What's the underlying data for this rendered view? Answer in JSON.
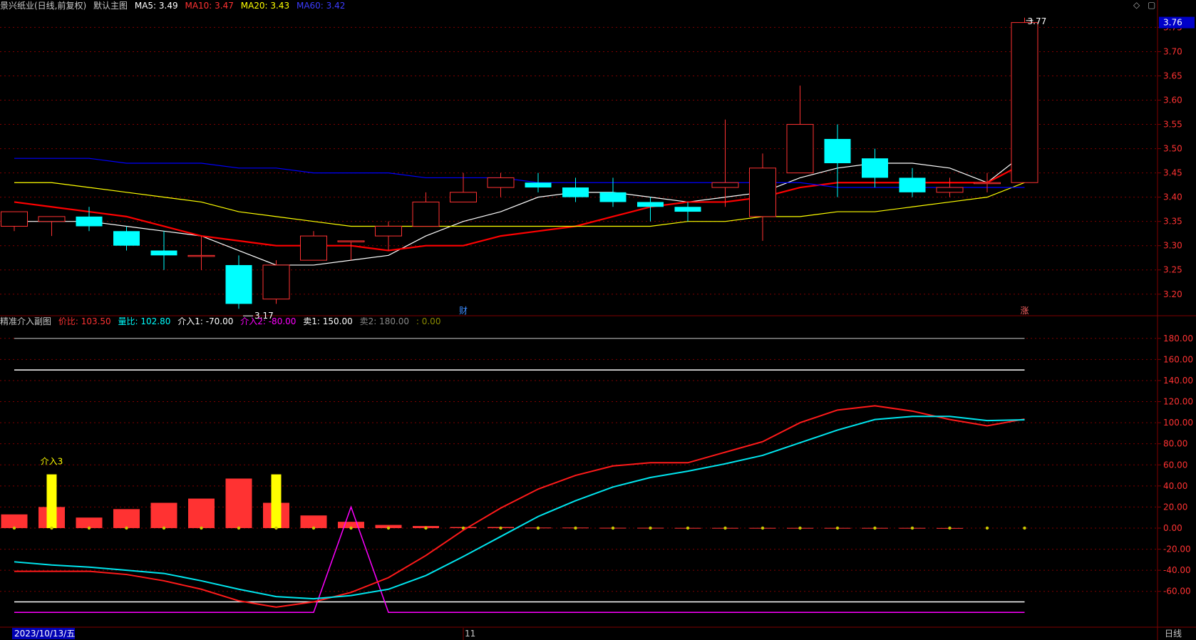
{
  "main_header": {
    "stock_title": "景兴纸业(日线,前复权)",
    "indicator_name": "默认主图",
    "ma5": "MA5: 3.49",
    "ma10": "MA10: 3.47",
    "ma20": "MA20: 3.43",
    "ma60": "MA60: 3.42"
  },
  "sub_header": {
    "indicator_name": "精准介入副图",
    "jiabi": "价比: 103.50",
    "liangbi": "量比: 102.80",
    "jieru1": "介入1: -70.00",
    "jieru2": "介入2: -80.00",
    "mai1": "卖1: 150.00",
    "mai2": "卖2: 180.00",
    "blank": ": 0.00"
  },
  "footer": {
    "date": "2023/10/13/五",
    "month_marker": "11",
    "period": "日线"
  },
  "colors": {
    "up": "#ff3232",
    "down": "#00ffff",
    "ma5": "#ffffff",
    "ma10": "#ff0000",
    "ma20": "#ffff00",
    "ma60": "#0000ff",
    "magenta": "#ff00ff",
    "yellow": "#ffff00",
    "grid": "#800000"
  },
  "chart_data": [
    {
      "type": "candlestick",
      "title": "默认主图",
      "ylim": [
        3.16,
        3.78
      ],
      "y_ticks": [
        "3.75",
        "3.70",
        "3.65",
        "3.60",
        "3.55",
        "3.50",
        "3.45",
        "3.40",
        "3.35",
        "3.30",
        "3.25",
        "3.20"
      ],
      "last_price_label": "3.76",
      "high_label": "3.77",
      "low_label": "3.17",
      "markers": [
        {
          "index": 12,
          "text": "财"
        },
        {
          "index": 27,
          "text": "涨"
        }
      ],
      "candles": [
        {
          "o": 3.34,
          "c": 3.37,
          "h": 3.37,
          "l": 3.33
        },
        {
          "o": 3.35,
          "c": 3.36,
          "h": 3.36,
          "l": 3.32
        },
        {
          "o": 3.36,
          "c": 3.34,
          "h": 3.38,
          "l": 3.33
        },
        {
          "o": 3.33,
          "c": 3.3,
          "h": 3.34,
          "l": 3.29
        },
        {
          "o": 3.29,
          "c": 3.28,
          "h": 3.33,
          "l": 3.25
        },
        {
          "o": 3.28,
          "c": 3.28,
          "h": 3.32,
          "l": 3.25
        },
        {
          "o": 3.26,
          "c": 3.18,
          "h": 3.28,
          "l": 3.17
        },
        {
          "o": 3.19,
          "c": 3.26,
          "h": 3.27,
          "l": 3.18
        },
        {
          "o": 3.27,
          "c": 3.32,
          "h": 3.33,
          "l": 3.27
        },
        {
          "o": 3.31,
          "c": 3.31,
          "h": 3.31,
          "l": 3.27
        },
        {
          "o": 3.32,
          "c": 3.34,
          "h": 3.35,
          "l": 3.29
        },
        {
          "o": 3.34,
          "c": 3.39,
          "h": 3.41,
          "l": 3.34
        },
        {
          "o": 3.39,
          "c": 3.41,
          "h": 3.45,
          "l": 3.39
        },
        {
          "o": 3.42,
          "c": 3.44,
          "h": 3.45,
          "l": 3.4
        },
        {
          "o": 3.43,
          "c": 3.42,
          "h": 3.45,
          "l": 3.41
        },
        {
          "o": 3.42,
          "c": 3.4,
          "h": 3.44,
          "l": 3.39
        },
        {
          "o": 3.41,
          "c": 3.39,
          "h": 3.44,
          "l": 3.38
        },
        {
          "o": 3.39,
          "c": 3.38,
          "h": 3.4,
          "l": 3.35
        },
        {
          "o": 3.38,
          "c": 3.37,
          "h": 3.39,
          "l": 3.35
        },
        {
          "o": 3.42,
          "c": 3.43,
          "h": 3.56,
          "l": 3.38
        },
        {
          "o": 3.36,
          "c": 3.46,
          "h": 3.49,
          "l": 3.31
        },
        {
          "o": 3.45,
          "c": 3.55,
          "h": 3.63,
          "l": 3.45
        },
        {
          "o": 3.52,
          "c": 3.47,
          "h": 3.55,
          "l": 3.4
        },
        {
          "o": 3.48,
          "c": 3.44,
          "h": 3.5,
          "l": 3.42
        },
        {
          "o": 3.44,
          "c": 3.41,
          "h": 3.46,
          "l": 3.4
        },
        {
          "o": 3.41,
          "c": 3.42,
          "h": 3.44,
          "l": 3.4
        },
        {
          "o": 3.43,
          "c": 3.43,
          "h": 3.45,
          "l": 3.41
        },
        {
          "o": 3.43,
          "c": 3.76,
          "h": 3.77,
          "l": 3.43
        }
      ],
      "series": [
        {
          "name": "MA5",
          "values": [
            3.35,
            3.35,
            3.35,
            3.34,
            3.33,
            3.32,
            3.29,
            3.26,
            3.26,
            3.27,
            3.28,
            3.32,
            3.35,
            3.37,
            3.4,
            3.41,
            3.41,
            3.4,
            3.39,
            3.4,
            3.41,
            3.44,
            3.46,
            3.47,
            3.47,
            3.46,
            3.43,
            3.49
          ]
        },
        {
          "name": "MA10",
          "values": [
            3.39,
            3.38,
            3.37,
            3.36,
            3.34,
            3.32,
            3.31,
            3.3,
            3.3,
            3.3,
            3.29,
            3.3,
            3.3,
            3.32,
            3.33,
            3.34,
            3.36,
            3.38,
            3.39,
            3.39,
            3.4,
            3.42,
            3.43,
            3.43,
            3.43,
            3.43,
            3.43,
            3.47
          ]
        },
        {
          "name": "MA20",
          "values": [
            3.43,
            3.43,
            3.42,
            3.41,
            3.4,
            3.39,
            3.37,
            3.36,
            3.35,
            3.34,
            3.34,
            3.34,
            3.34,
            3.34,
            3.34,
            3.34,
            3.34,
            3.34,
            3.35,
            3.35,
            3.36,
            3.36,
            3.37,
            3.37,
            3.38,
            3.39,
            3.4,
            3.43
          ]
        },
        {
          "name": "MA60",
          "values": [
            3.48,
            3.48,
            3.48,
            3.47,
            3.47,
            3.47,
            3.46,
            3.46,
            3.45,
            3.45,
            3.45,
            3.44,
            3.44,
            3.44,
            3.43,
            3.43,
            3.43,
            3.43,
            3.43,
            3.43,
            3.43,
            3.43,
            3.42,
            3.42,
            3.42,
            3.42,
            3.42,
            3.42
          ]
        }
      ]
    },
    {
      "type": "line",
      "title": "精准介入副图",
      "ylim": [
        -94,
        190
      ],
      "y_ticks": [
        "180.00",
        "160.00",
        "140.00",
        "120.00",
        "100.00",
        "80.00",
        "60.00",
        "40.00",
        "20.00",
        "0.00",
        "-20.00",
        "-40.00",
        "-60.00"
      ],
      "annotation": "介入3",
      "red_bars": [
        13,
        20,
        10,
        18,
        24,
        28,
        47,
        24,
        12,
        6,
        3,
        2,
        1,
        1,
        0.5,
        0.5,
        0.3,
        0.3,
        0.2,
        0.2,
        0.2,
        0.2,
        0.2,
        0.2,
        0.2,
        0.1,
        0,
        0
      ],
      "yellow_bars": [
        0,
        51,
        0,
        0,
        0,
        0,
        0,
        51,
        0,
        0,
        0,
        0,
        0,
        0,
        0,
        0,
        0,
        0,
        0,
        0,
        0,
        0,
        0,
        0,
        0,
        0,
        0,
        0
      ],
      "series": [
        {
          "name": "价比",
          "values": [
            -41,
            -41,
            -41,
            -44,
            -50,
            -58,
            -69,
            -75,
            -70,
            -61,
            -47,
            -26,
            -2,
            19,
            37,
            50,
            59,
            62,
            62,
            72,
            82,
            100,
            112,
            116,
            111,
            103,
            97,
            103.5
          ]
        },
        {
          "name": "量比",
          "values": [
            -32,
            -35,
            -37,
            -40,
            -43,
            -50,
            -58,
            -65,
            -67,
            -64,
            -58,
            -45,
            -27,
            -8,
            11,
            26,
            39,
            48,
            54,
            61,
            69,
            81,
            93,
            103,
            106,
            106,
            102,
            102.8
          ]
        },
        {
          "name": "介入1",
          "values": [
            -70,
            -70,
            -70,
            -70,
            -70,
            -70,
            -70,
            -70,
            -70,
            -70,
            -70,
            -70,
            -70,
            -70,
            -70,
            -70,
            -70,
            -70,
            -70,
            -70,
            -70,
            -70,
            -70,
            -70,
            -70,
            -70,
            -70,
            -70
          ]
        },
        {
          "name": "介入2",
          "values": [
            -80,
            -80,
            -80,
            -80,
            -80,
            -80,
            -80,
            -80,
            -80,
            20,
            -80,
            -80,
            -80,
            -80,
            -80,
            -80,
            -80,
            -80,
            -80,
            -80,
            -80,
            -80,
            -80,
            -80,
            -80,
            -80,
            -80,
            -80
          ]
        },
        {
          "name": "卖1",
          "values": [
            150,
            150,
            150,
            150,
            150,
            150,
            150,
            150,
            150,
            150,
            150,
            150,
            150,
            150,
            150,
            150,
            150,
            150,
            150,
            150,
            150,
            150,
            150,
            150,
            150,
            150,
            150,
            150
          ]
        },
        {
          "name": "卖2",
          "values": [
            180,
            180,
            180,
            180,
            180,
            180,
            180,
            180,
            180,
            180,
            180,
            180,
            180,
            180,
            180,
            180,
            180,
            180,
            180,
            180,
            180,
            180,
            180,
            180,
            180,
            180,
            180,
            180
          ]
        }
      ]
    }
  ]
}
